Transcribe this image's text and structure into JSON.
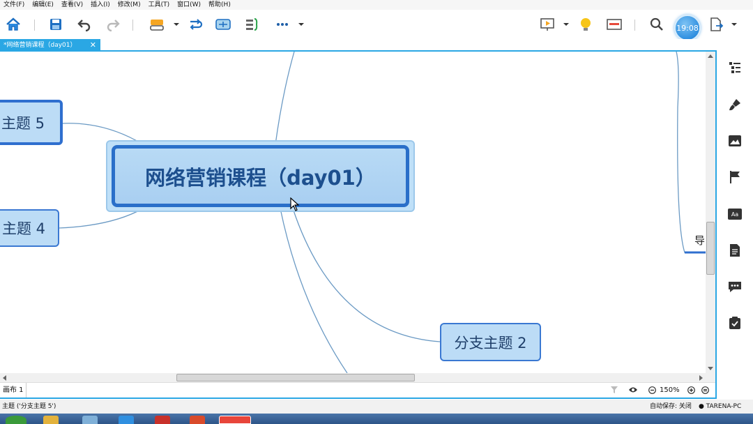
{
  "menubar": {
    "items": [
      "文件(F)",
      "编辑(E)",
      "查看(V)",
      "插入(I)",
      "修改(M)",
      "工具(T)",
      "窗口(W)",
      "帮助(H)"
    ]
  },
  "toolbar": {
    "icons": [
      "home-icon",
      "save-icon",
      "undo-icon",
      "redo-icon",
      "insert-topic-icon",
      "relationship-icon",
      "boundary-icon",
      "summary-icon",
      "more-icon",
      "presentation-icon",
      "brainstorm-icon",
      "layout-icon",
      "search-icon",
      "export-icon"
    ],
    "clock": "19:08"
  },
  "document_tab": {
    "label": "*网络营销课程（day01）",
    "close_glyph": "✕"
  },
  "mindmap": {
    "central_topic": "网络营销课程（day01）",
    "topics": [
      {
        "id": "topic-5",
        "label": "主题 5"
      },
      {
        "id": "topic-4",
        "label": "主题 4"
      },
      {
        "id": "branch-topic-2",
        "label": "分支主题 2"
      },
      {
        "id": "topic-right",
        "label": "导"
      }
    ],
    "colors": {
      "topic_fill": "#bcdcf6",
      "topic_border": "#2f6fcf",
      "link": "#6b9ac4"
    }
  },
  "sheet": {
    "tab_label": "画布 1",
    "zoom": "150%"
  },
  "statusbar": {
    "selection": "主题 ('分支主题 5')",
    "autosave": "自动保存: 关闭",
    "user": "TARENA-PC"
  },
  "sidebar": {
    "icons": [
      "outline-icon",
      "format-brush-icon",
      "image-icon",
      "marker-flag-icon",
      "text-style-icon",
      "notes-icon",
      "comment-icon",
      "task-icon"
    ]
  }
}
